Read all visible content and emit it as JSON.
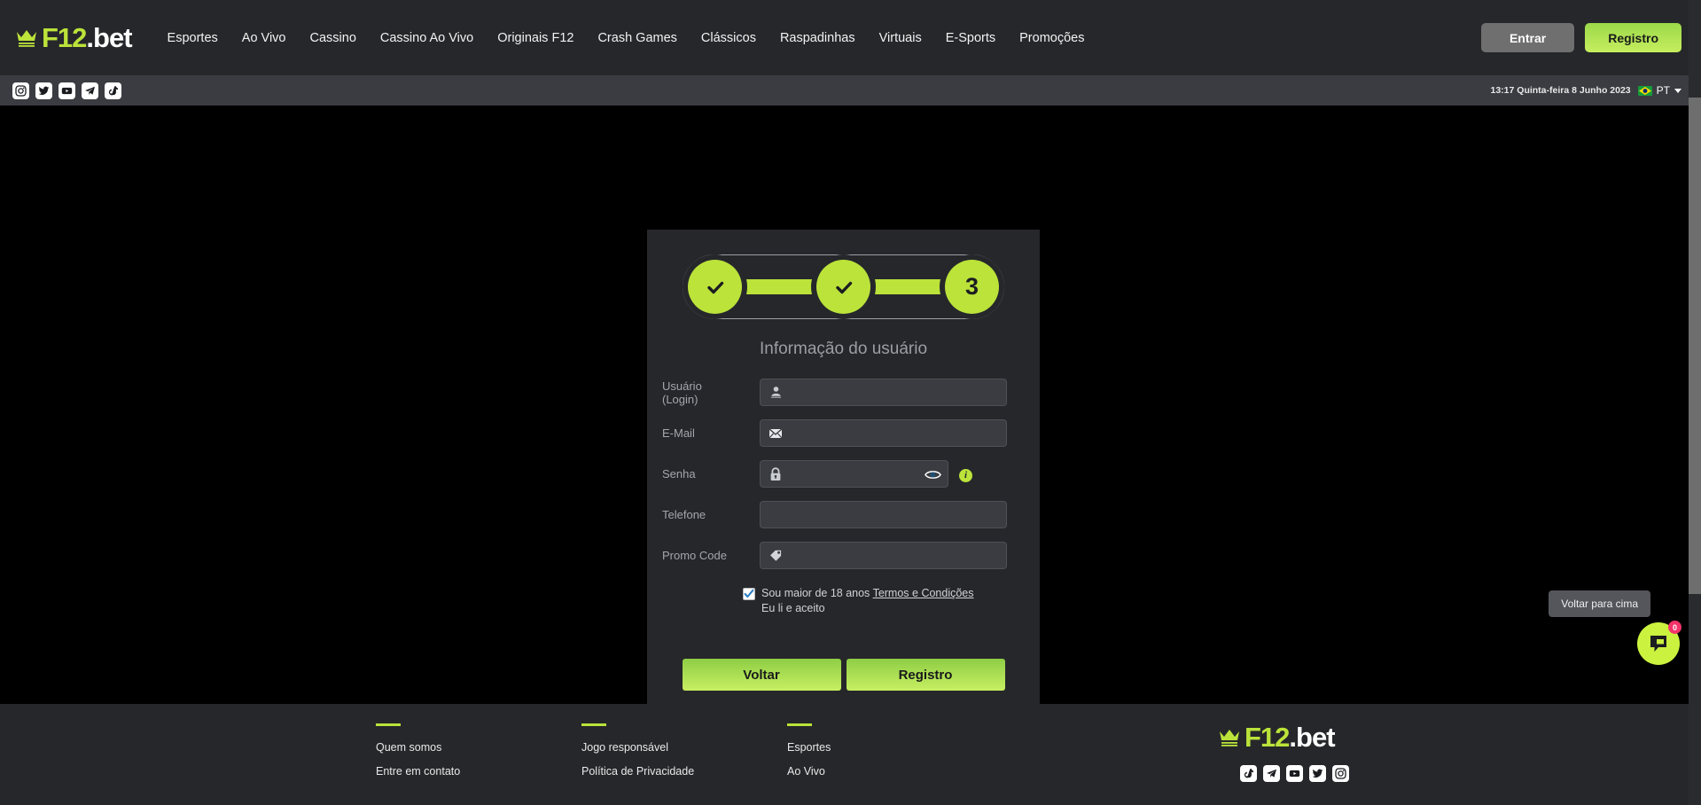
{
  "brand": {
    "name_green": "F12",
    "name_white": ".bet",
    "icon": "crown-icon"
  },
  "topnav": {
    "links": [
      "Esportes",
      "Ao Vivo",
      "Cassino",
      "Cassino Ao Vivo",
      "Originais F12",
      "Crash Games",
      "Clássicos",
      "Raspadinhas",
      "Virtuais",
      "E-Sports",
      "Promoções"
    ],
    "login_label": "Entrar",
    "register_label": "Registro"
  },
  "socialbar": {
    "icons": [
      "instagram-icon",
      "twitter-icon",
      "youtube-icon",
      "telegram-icon",
      "tiktok-icon"
    ],
    "datetime": "13:17 Quinta-feira 8 Junho 2023",
    "language": "PT",
    "flag": "brazil-flag-icon"
  },
  "registration": {
    "steps": {
      "total": 3,
      "current": 3,
      "completed": [
        1,
        2
      ],
      "current_label": "3"
    },
    "title": "Informação do usuário",
    "fields": [
      {
        "label": "Usuário\n(Login)",
        "label_line1": "Usuário",
        "label_line2": "(Login)",
        "value": "",
        "placeholder": "",
        "icon": "user-icon"
      },
      {
        "label": "E-Mail",
        "value": "",
        "placeholder": "",
        "icon": "envelope-icon"
      },
      {
        "label": "Senha",
        "value": "",
        "placeholder": "",
        "icon": "lock-icon",
        "toggle": "eye-icon",
        "info": "info-icon"
      },
      {
        "label": "Telefone",
        "value": "",
        "placeholder": "",
        "icon": ""
      },
      {
        "label": "Promo Code",
        "value": "",
        "placeholder": "",
        "icon": "tag-icon"
      }
    ],
    "agreement": {
      "checked": true,
      "text_before": "Sou maior de 18 anos ",
      "link": "Termos e Condições",
      "text_after": "Eu li e aceito"
    },
    "back_label": "Voltar",
    "submit_label": "Registro"
  },
  "footer": {
    "columns": [
      {
        "links": [
          "Quem somos",
          "Entre em contato"
        ]
      },
      {
        "links": [
          "Jogo responsável",
          "Política de Privacidade"
        ]
      },
      {
        "links": [
          "Esportes",
          "Ao Vivo"
        ]
      }
    ],
    "social": [
      "tiktok-icon",
      "telegram-icon",
      "youtube-icon",
      "twitter-icon",
      "instagram-icon"
    ]
  },
  "widgets": {
    "back_to_top": "Voltar para cima",
    "chat_badge": "0",
    "chat_icon": "chat-bubble-icon"
  },
  "colors": {
    "accent_green": "#bbe33a",
    "page_bg": "#000000",
    "panel_bg": "#26272b",
    "strip_bg": "#3a3c41",
    "badge_red": "#f3336a"
  }
}
